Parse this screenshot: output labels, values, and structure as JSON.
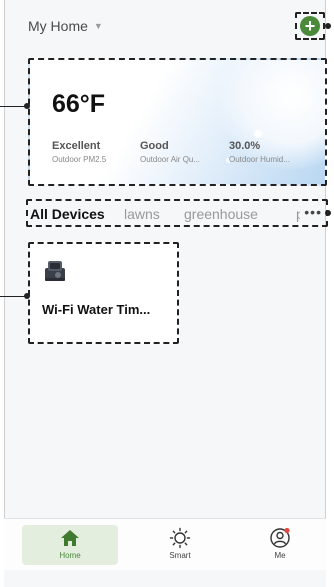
{
  "header": {
    "home_title": "My Home",
    "caret_icon": "caret-down-icon",
    "add_icon": "plus-circle-icon",
    "add_symbol": "+",
    "accent_color": "#4b8a3a"
  },
  "weather": {
    "temperature": "66°F",
    "stats": [
      {
        "value": "Excellent",
        "label": "Outdoor PM2.5"
      },
      {
        "value": "Good",
        "label": "Outdoor Air Qu..."
      },
      {
        "value": "30.0%",
        "label": "Outdoor Humid..."
      }
    ]
  },
  "tabs": {
    "items": [
      {
        "label": "All Devices",
        "active": true
      },
      {
        "label": "lawns",
        "active": false
      },
      {
        "label": "greenhouse",
        "active": false
      },
      {
        "label": "po",
        "active": false
      }
    ],
    "more": "•••"
  },
  "devices": [
    {
      "name": "Wi-Fi Water Tim...",
      "icon": "water-timer-device-icon"
    }
  ],
  "bottom_nav": {
    "items": [
      {
        "label": "Home",
        "icon": "home-icon",
        "active": true
      },
      {
        "label": "Smart",
        "icon": "sun-icon",
        "active": false
      },
      {
        "label": "Me",
        "icon": "user-icon",
        "active": false
      }
    ]
  }
}
